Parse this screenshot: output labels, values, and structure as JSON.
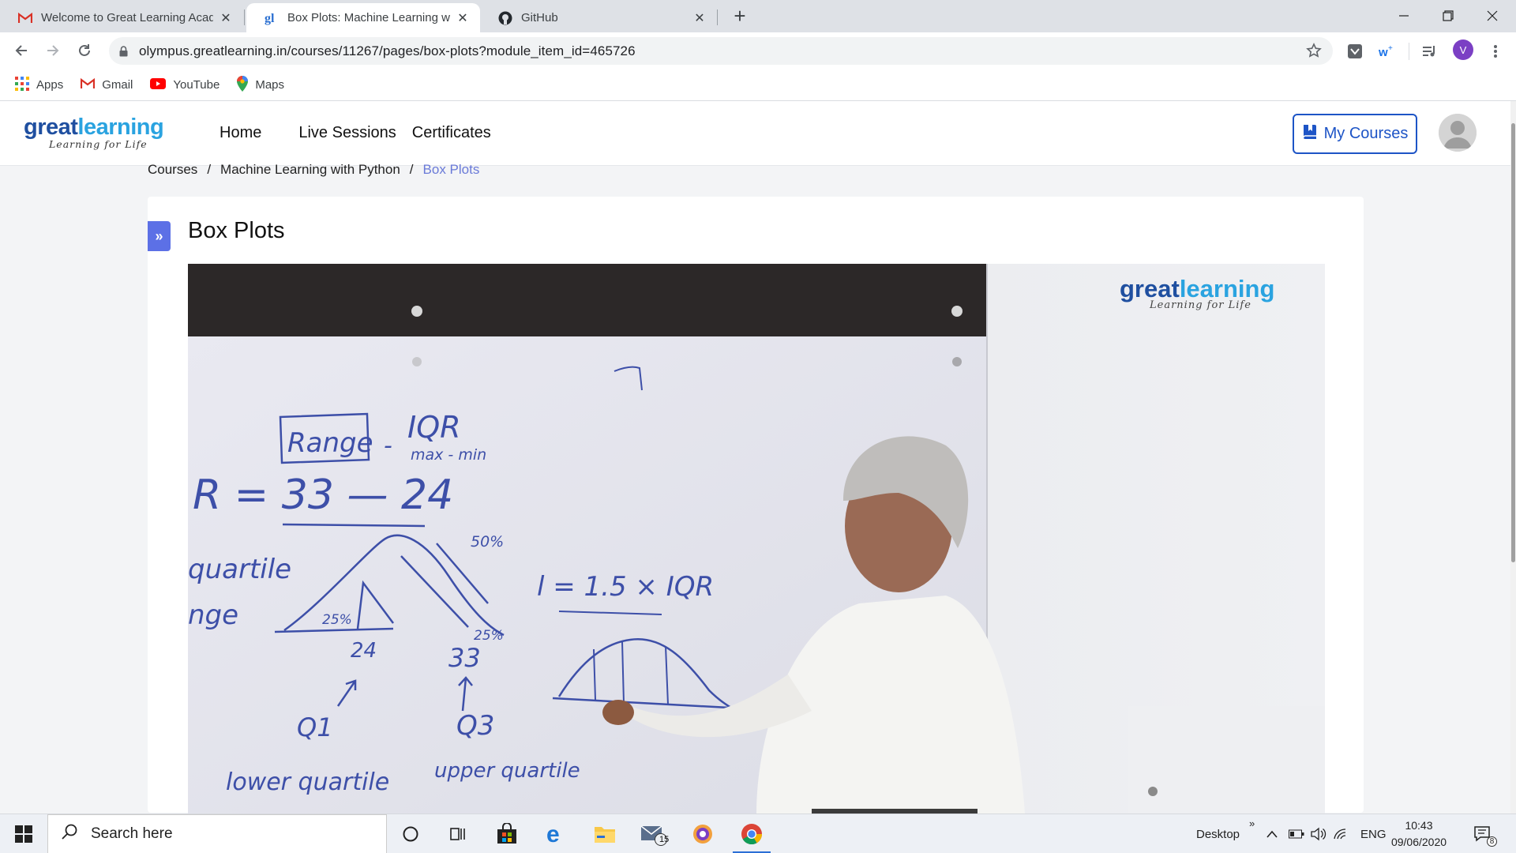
{
  "browser": {
    "tabs": [
      {
        "title": "Welcome to Great Learning Acad",
        "favicon": "gmail-icon"
      },
      {
        "title": "Box Plots: Machine Learning with",
        "favicon": "greatlearning-icon"
      },
      {
        "title": "GitHub",
        "favicon": "github-icon"
      }
    ],
    "url": "olympus.greatlearning.in/courses/11267/pages/box-plots?module_item_id=465726",
    "profile_initial": "V",
    "bookmarks": [
      {
        "label": "Apps",
        "icon": "apps-grid-icon"
      },
      {
        "label": "Gmail",
        "icon": "gmail-icon"
      },
      {
        "label": "YouTube",
        "icon": "youtube-icon"
      },
      {
        "label": "Maps",
        "icon": "maps-icon"
      }
    ]
  },
  "site": {
    "logo": {
      "part1": "great",
      "part2": "learning",
      "tagline": "Learning for Life"
    },
    "nav": [
      "Home",
      "Live Sessions",
      "Certificates"
    ],
    "my_courses_label": "My Courses",
    "accent": "#1d54c6"
  },
  "breadcrumb": {
    "items": [
      "Courses",
      "Machine Learning with Python",
      "Box Plots"
    ],
    "separator": "/"
  },
  "page": {
    "title": "Box Plots",
    "toggle_label": "»"
  },
  "video": {
    "watermark_part1": "great",
    "watermark_part2": "learning",
    "watermark_tagline": "Learning for Life",
    "whiteboard": {
      "range_box": "Range",
      "dash": "-",
      "iqr_label": "IQR",
      "max_min": "max - min",
      "iqr_calc": "R = 33 — 24",
      "quartile_left": "quartile",
      "range_left": "nge",
      "val_24": "24",
      "val_33": "33",
      "pct_25": "25%",
      "pct_50": "50%",
      "pct_25b": "25%",
      "q1": "Q1",
      "q3": "Q3",
      "lower_q": "lower quartile",
      "upper_q": "upper quartile",
      "whisker": "l = 1.5 × IQR"
    }
  },
  "taskbar": {
    "search_placeholder": "Search here",
    "desktop_label": "Desktop",
    "language": "ENG",
    "time": "10:43",
    "date": "09/06/2020",
    "mail_badge": "15",
    "notification_badge": "8"
  }
}
